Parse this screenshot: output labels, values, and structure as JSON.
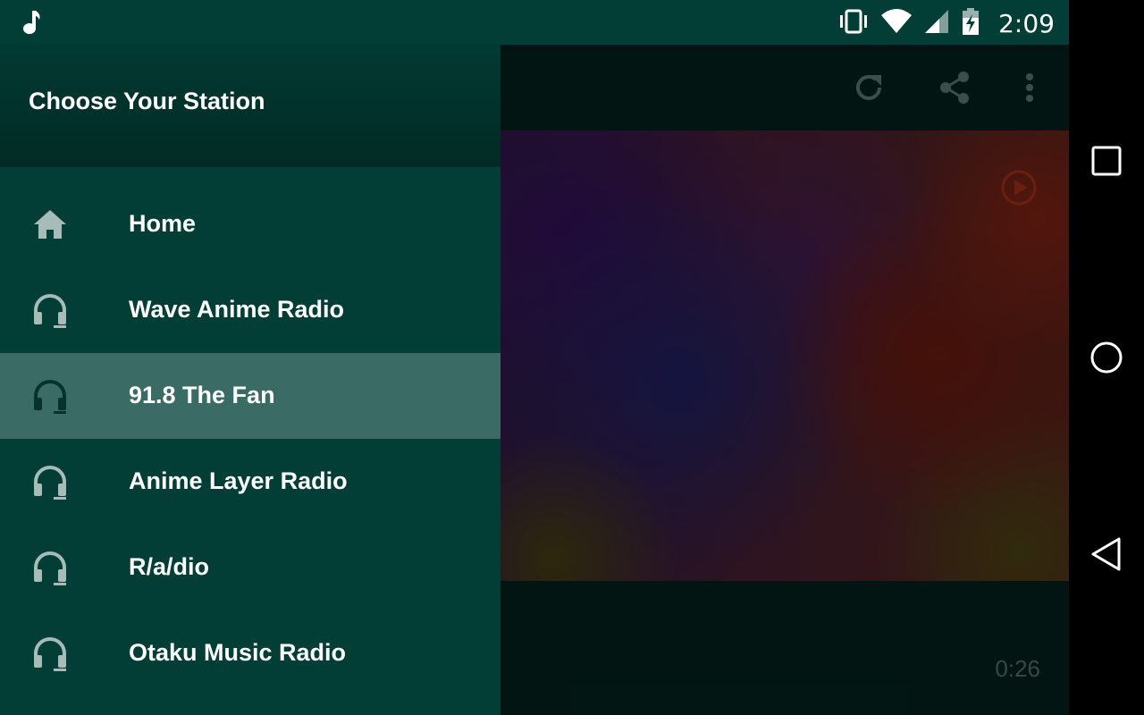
{
  "status_bar": {
    "time": "2:09",
    "icons": [
      "music-note-icon",
      "vibrate-icon",
      "wifi-icon",
      "cell-signal-icon",
      "battery-charging-icon"
    ]
  },
  "drawer": {
    "title": "Choose Your Station",
    "items": [
      {
        "label": "Home",
        "icon": "home-icon",
        "selected": false
      },
      {
        "label": "Wave Anime Radio",
        "icon": "headphones-icon",
        "selected": false
      },
      {
        "label": "91.8 The Fan",
        "icon": "headphones-icon",
        "selected": true
      },
      {
        "label": "Anime Layer Radio",
        "icon": "headphones-icon",
        "selected": false
      },
      {
        "label": "R/a/dio",
        "icon": "headphones-icon",
        "selected": false
      },
      {
        "label": "Otaku Music Radio",
        "icon": "headphones-icon",
        "selected": false
      }
    ]
  },
  "toolbar": {
    "actions": [
      "refresh-icon",
      "share-icon",
      "more-vert-icon"
    ]
  },
  "player": {
    "elapsed": "0:26",
    "overlay_icon": "play-circle-icon"
  },
  "nav_bar": {
    "buttons": [
      "recents-button",
      "home-button",
      "back-button"
    ]
  },
  "colors": {
    "drawer_bg": "#023e36",
    "selected_bg": "#3a6b64",
    "status_bar": "#023e36",
    "icon_tint": "#a7bcb8"
  }
}
